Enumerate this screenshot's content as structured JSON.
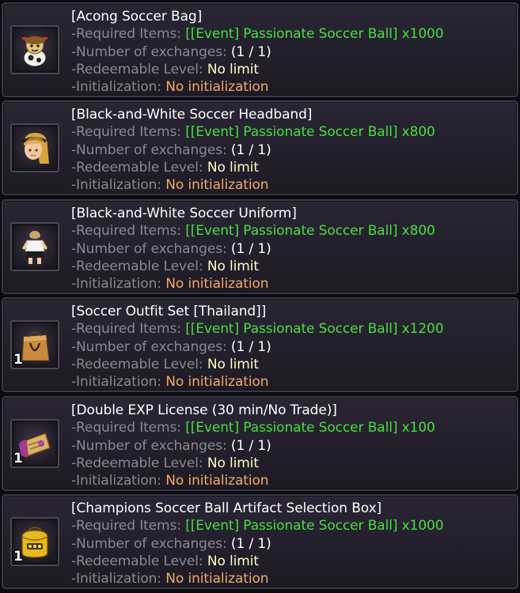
{
  "labels": {
    "required_items": "-Required Items:",
    "number_of_exchanges": "-Number of exchanges:",
    "redeemable_level": "-Redeemable Level:",
    "initialization": "-Initialization:"
  },
  "colors": {
    "title": "#ffffff",
    "label": "#8a8893",
    "required_value": "#46e03f",
    "exchanges_value": "#ffffff",
    "level_value": "#fffcc4",
    "initialization_value": "#f4aa66"
  },
  "items": [
    {
      "title": "[Acong Soccer Bag]",
      "required_items": "[[Event] Passionate Soccer Ball] x1000",
      "number_of_exchanges": "(1 / 1)",
      "redeemable_level": "No limit",
      "initialization": "No initialization",
      "icon": "soccer-bag-icon",
      "quantity": ""
    },
    {
      "title": "[Black-and-White Soccer Headband]",
      "required_items": "[[Event] Passionate Soccer Ball] x800",
      "number_of_exchanges": "(1 / 1)",
      "redeemable_level": "No limit",
      "initialization": "No initialization",
      "icon": "headband-icon",
      "quantity": ""
    },
    {
      "title": "[Black-and-White Soccer Uniform]",
      "required_items": "[[Event] Passionate Soccer Ball] x800",
      "number_of_exchanges": "(1 / 1)",
      "redeemable_level": "No limit",
      "initialization": "No initialization",
      "icon": "uniform-icon",
      "quantity": ""
    },
    {
      "title": "[Soccer Outfit Set [Thailand]]",
      "required_items": "[[Event] Passionate Soccer Ball] x1200",
      "number_of_exchanges": "(1 / 1)",
      "redeemable_level": "No limit",
      "initialization": "No initialization",
      "icon": "shopping-bag-icon",
      "quantity": "1"
    },
    {
      "title": "[Double EXP License (30 min/No Trade)]",
      "required_items": "[[Event] Passionate Soccer Ball] x100",
      "number_of_exchanges": "(1 / 1)",
      "redeemable_level": "No limit",
      "initialization": "No initialization",
      "icon": "exp-license-icon",
      "quantity": "1"
    },
    {
      "title": "[Champions Soccer Ball Artifact Selection Box]",
      "required_items": "[[Event] Passionate Soccer Ball] x1000",
      "number_of_exchanges": "(1 / 1)",
      "redeemable_level": "No limit",
      "initialization": "No initialization",
      "icon": "selection-box-icon",
      "quantity": "1"
    }
  ]
}
